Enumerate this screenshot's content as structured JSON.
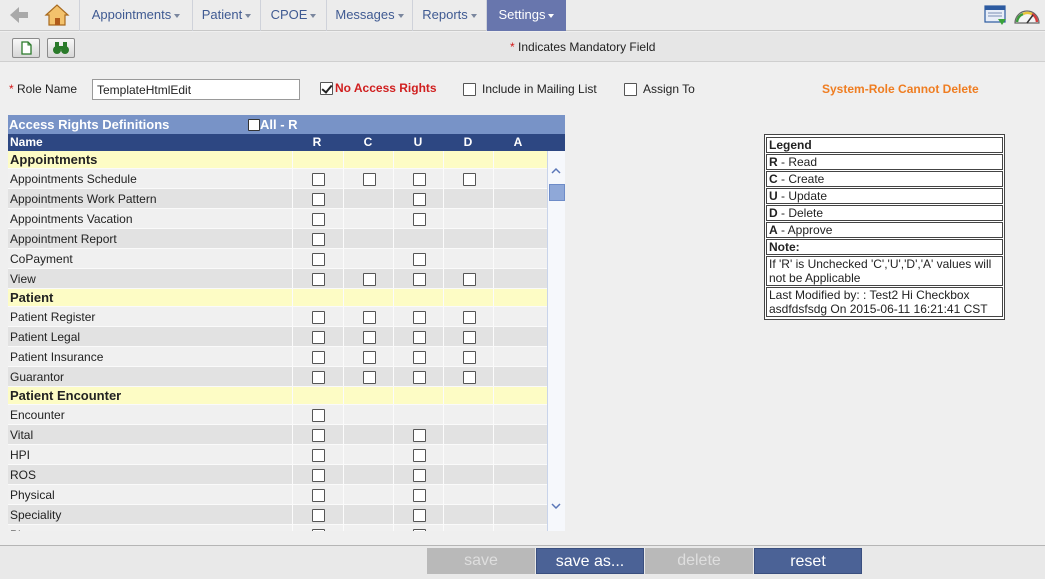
{
  "nav": {
    "tabs": [
      {
        "label": "Appointments"
      },
      {
        "label": "Patient"
      },
      {
        "label": "CPOE"
      },
      {
        "label": "Messages"
      },
      {
        "label": "Reports"
      },
      {
        "label": "Settings"
      }
    ],
    "active_tab": "Settings"
  },
  "toolbar": {
    "mandatory_note": "Indicates Mandatory Field"
  },
  "form": {
    "role_name_label": "Role Name",
    "role_name_value": "TemplateHtmlEdit",
    "no_access_label": "No Access Rights",
    "no_access_checked": true,
    "mailing_label": "Include in Mailing List",
    "assign_label": "Assign To",
    "system_role_note": "System-Role Cannot Delete"
  },
  "table": {
    "title": "Access Rights Definitions",
    "all_label": "All - R",
    "columns": {
      "name": "Name",
      "r": "R",
      "c": "C",
      "u": "U",
      "d": "D",
      "a": "A"
    },
    "rows": [
      {
        "type": "section",
        "label": "Appointments"
      },
      {
        "type": "item",
        "label": "Appointments Schedule",
        "cb": [
          1,
          1,
          1,
          1,
          0
        ]
      },
      {
        "type": "item",
        "label": "Appointments Work Pattern",
        "cb": [
          1,
          0,
          1,
          0,
          0
        ]
      },
      {
        "type": "item",
        "label": "Appointments Vacation",
        "cb": [
          1,
          0,
          1,
          0,
          0
        ]
      },
      {
        "type": "item",
        "label": "Appointment Report",
        "cb": [
          1,
          0,
          0,
          0,
          0
        ]
      },
      {
        "type": "item",
        "label": "CoPayment",
        "cb": [
          1,
          0,
          1,
          0,
          0
        ]
      },
      {
        "type": "item",
        "label": "View",
        "cb": [
          1,
          1,
          1,
          1,
          0
        ]
      },
      {
        "type": "section",
        "label": "Patient"
      },
      {
        "type": "item",
        "label": "Patient Register",
        "cb": [
          1,
          1,
          1,
          1,
          0
        ]
      },
      {
        "type": "item",
        "label": "Patient Legal",
        "cb": [
          1,
          1,
          1,
          1,
          0
        ]
      },
      {
        "type": "item",
        "label": "Patient Insurance",
        "cb": [
          1,
          1,
          1,
          1,
          0
        ]
      },
      {
        "type": "item",
        "label": "Guarantor",
        "cb": [
          1,
          1,
          1,
          1,
          0
        ]
      },
      {
        "type": "section",
        "label": "Patient Encounter"
      },
      {
        "type": "item",
        "label": "Encounter",
        "cb": [
          1,
          0,
          0,
          0,
          0
        ]
      },
      {
        "type": "item",
        "label": "Vital",
        "cb": [
          1,
          0,
          1,
          0,
          0
        ]
      },
      {
        "type": "item",
        "label": "HPI",
        "cb": [
          1,
          0,
          1,
          0,
          0
        ]
      },
      {
        "type": "item",
        "label": "ROS",
        "cb": [
          1,
          0,
          1,
          0,
          0
        ]
      },
      {
        "type": "item",
        "label": "Physical",
        "cb": [
          1,
          0,
          1,
          0,
          0
        ]
      },
      {
        "type": "item",
        "label": "Speciality",
        "cb": [
          1,
          0,
          1,
          0,
          0
        ]
      },
      {
        "type": "item",
        "label": "Pictures",
        "cb": [
          1,
          0,
          1,
          0,
          0
        ]
      }
    ]
  },
  "legend": {
    "title": "Legend",
    "r_key": "R",
    "r_text": " - Read",
    "c_key": "C",
    "c_text": " - Create",
    "u_key": "U",
    "u_text": " - Update",
    "d_key": "D",
    "d_text": " - Delete",
    "a_key": "A",
    "a_text": " - Approve",
    "note_title": "Note:",
    "note_text": "If 'R' is Unchecked 'C','U','D','A' values will not be Applicable",
    "modified_text": "Last Modified by: : Test2 Hi Checkbox asdfdsfsdg On 2015-06-11 16:21:41 CST"
  },
  "buttons": {
    "save": "save",
    "save_as": "save as...",
    "delete": "delete",
    "reset": "reset"
  },
  "colors": {
    "nav_active": "#6876ad",
    "header_blue": "#2d4782",
    "panel_blue": "#7893c7",
    "section_yellow": "#fdfcc5",
    "warning_orange": "#ef7d21",
    "error_red": "#d01f1f"
  }
}
